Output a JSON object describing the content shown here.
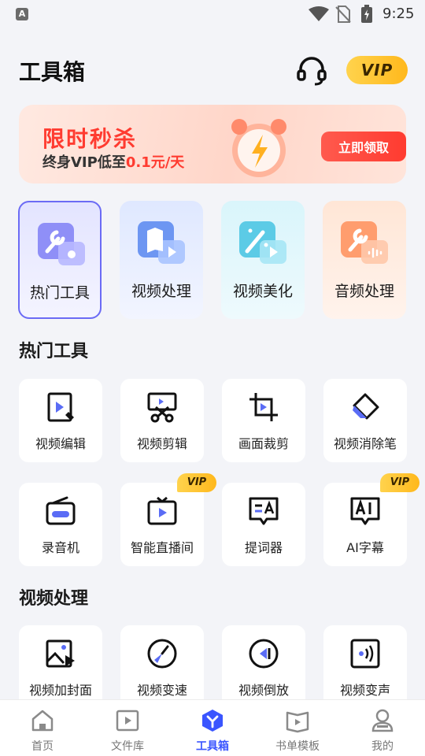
{
  "status_bar": {
    "notification_icon": "A",
    "time": "9:25",
    "icons": [
      "wifi-icon",
      "no-sim-icon",
      "battery-charging-icon"
    ]
  },
  "header": {
    "title": "工具箱",
    "support_icon": "headset-icon",
    "vip_label": "VIP"
  },
  "banner": {
    "title": "限时秒杀",
    "subtitle_prefix": "终身VIP低至",
    "subtitle_highlight": "0.1元/天",
    "button_label": "立即领取"
  },
  "categories": [
    {
      "label": "热门工具",
      "icon": "tools-icon",
      "selected": true
    },
    {
      "label": "视频处理",
      "icon": "video-process-icon",
      "selected": false
    },
    {
      "label": "视频美化",
      "icon": "magic-wand-icon",
      "selected": false
    },
    {
      "label": "音频处理",
      "icon": "audio-wrench-icon",
      "selected": false
    }
  ],
  "sections": {
    "hot_tools": {
      "title": "热门工具",
      "items": [
        {
          "label": "视频编辑",
          "icon": "video-edit-icon",
          "vip": false
        },
        {
          "label": "视频剪辑",
          "icon": "scissors-icon",
          "vip": false
        },
        {
          "label": "画面裁剪",
          "icon": "crop-icon",
          "vip": false
        },
        {
          "label": "视频消除笔",
          "icon": "eraser-icon",
          "vip": false
        },
        {
          "label": "录音机",
          "icon": "radio-icon",
          "vip": false
        },
        {
          "label": "智能直播间",
          "icon": "tv-play-icon",
          "vip": true
        },
        {
          "label": "提词器",
          "icon": "teleprompter-icon",
          "vip": false
        },
        {
          "label": "AI字幕",
          "icon": "ai-subtitle-icon",
          "vip": true
        }
      ]
    },
    "video_process": {
      "title": "视频处理",
      "items": [
        {
          "label": "视频加封面",
          "icon": "cover-image-icon",
          "vip": false
        },
        {
          "label": "视频变速",
          "icon": "speedometer-icon",
          "vip": false
        },
        {
          "label": "视频倒放",
          "icon": "rewind-icon",
          "vip": false
        },
        {
          "label": "视频变声",
          "icon": "voice-change-icon",
          "vip": false
        }
      ]
    }
  },
  "vip_tag": "VIP",
  "colors": {
    "accent": "#3a55ff",
    "red": "#ff3b30",
    "vip_gold": "#ffc233",
    "selected_border": "#6b6bf5"
  },
  "bottom_nav": [
    {
      "label": "首页",
      "icon": "home-icon",
      "active": false
    },
    {
      "label": "文件库",
      "icon": "video-library-icon",
      "active": false
    },
    {
      "label": "工具箱",
      "icon": "toolbox-icon",
      "active": true
    },
    {
      "label": "书单模板",
      "icon": "book-icon",
      "active": false
    },
    {
      "label": "我的",
      "icon": "person-icon",
      "active": false
    }
  ]
}
